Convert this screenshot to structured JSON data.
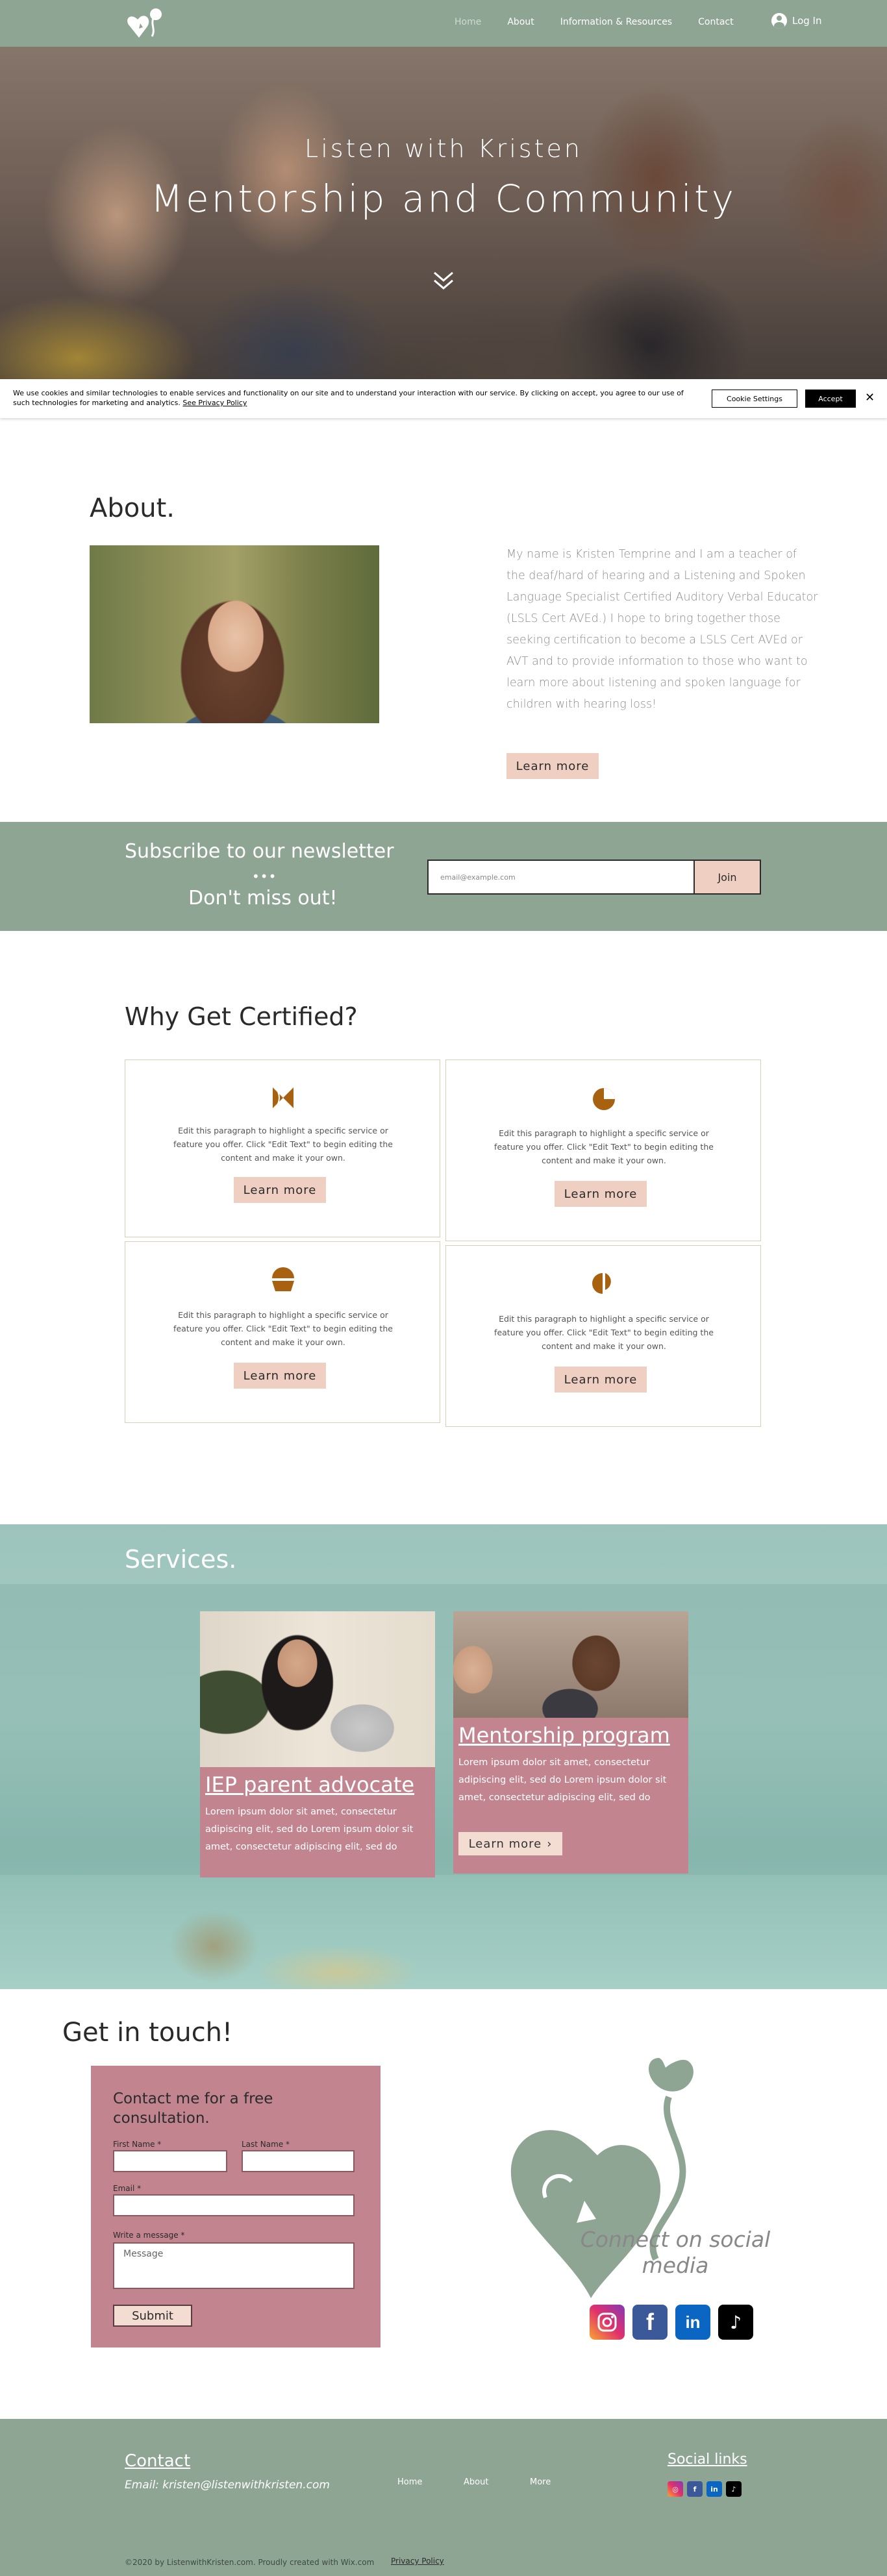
{
  "colors": {
    "sage": "#8ea594",
    "rose": "#c28590",
    "blush": "#efcfc2",
    "icon_brown": "#a8620f"
  },
  "header": {
    "nav": [
      "Home",
      "About",
      "Information & Resources",
      "Contact"
    ],
    "active": "Home",
    "login": "Log In"
  },
  "hero": {
    "subtitle": "Listen with Kristen",
    "title": "Mentorship and Community"
  },
  "cookie": {
    "text": "We use cookies and similar technologies to enable services and functionality on our site and to understand your interaction with our service. By clicking on accept, you agree to our use of such technologies for marketing and analytics.",
    "link": "See Privacy Policy",
    "settings": "Cookie Settings",
    "accept": "Accept"
  },
  "about": {
    "title": "About.",
    "text": "My name is Kristen Temprine and I am a teacher of the deaf/hard of hearing and a Listening and Spoken Language Specialist Certified Auditory Verbal Educator (LSLS Cert AVEd.) I hope to bring together those seeking certification to become a LSLS Cert AVEd or AVT and to provide information to those who want to learn more about listening and spoken language for children with hearing loss!",
    "button": "Learn more"
  },
  "newsletter": {
    "title": "Subscribe to our newsletter",
    "dots": "•••",
    "subtitle": "Don't miss out!",
    "placeholder": "email@example.com",
    "button": "Join"
  },
  "why": {
    "title": "Why Get Certified?",
    "cards": [
      {
        "icon": "bowtie-icon",
        "text": "Edit this paragraph to highlight a specific service or feature you offer. Click \"Edit Text\" to begin editing the content and make it your own.",
        "button": "Learn more"
      },
      {
        "icon": "pie-icon",
        "text": "Edit this paragraph to highlight a specific service or feature you offer. Click \"Edit Text\" to begin editing the content and make it your own.",
        "button": "Learn more"
      },
      {
        "icon": "half-circles-icon",
        "text": "Edit this paragraph to highlight a specific service or feature you offer. Click \"Edit Text\" to begin editing the content and make it your own.",
        "button": "Learn more"
      },
      {
        "icon": "split-circle-icon",
        "text": "Edit this paragraph to highlight a specific service or feature you offer. Click \"Edit Text\" to begin editing the content and make it your own.",
        "button": "Learn more"
      }
    ]
  },
  "services": {
    "title": "Services.",
    "items": [
      {
        "title": "IEP parent advocate",
        "body": "Lorem ipsum dolor sit amet, consectetur adipiscing elit, sed do Lorem ipsum dolor sit amet, consectetur adipiscing elit, sed do"
      },
      {
        "title": "Mentorship program",
        "body": "Lorem ipsum dolor sit amet, consectetur adipiscing elit, sed do Lorem ipsum dolor sit amet, consectetur adipiscing elit, sed do",
        "button": "Learn more"
      }
    ]
  },
  "contact": {
    "title": "Get in touch!",
    "form_heading": "Contact me for a free consultation.",
    "first_name": "First Name *",
    "last_name": "Last Name *",
    "email": "Email *",
    "message_label": "Write a message *",
    "message_placeholder": "Message",
    "submit": "Submit",
    "connect": "Connect on social media",
    "social": [
      "instagram-icon",
      "facebook-icon",
      "linkedin-icon",
      "tiktok-icon"
    ]
  },
  "footer": {
    "contact": "Contact",
    "email": "Email: kristen@listenwithkristen.com",
    "nav": [
      "Home",
      "About",
      "More"
    ],
    "social_title": "Social links",
    "copyright": "©2020 by ListenwithKristen.com. Proudly created with Wix.com",
    "privacy": "Privacy Policy"
  }
}
